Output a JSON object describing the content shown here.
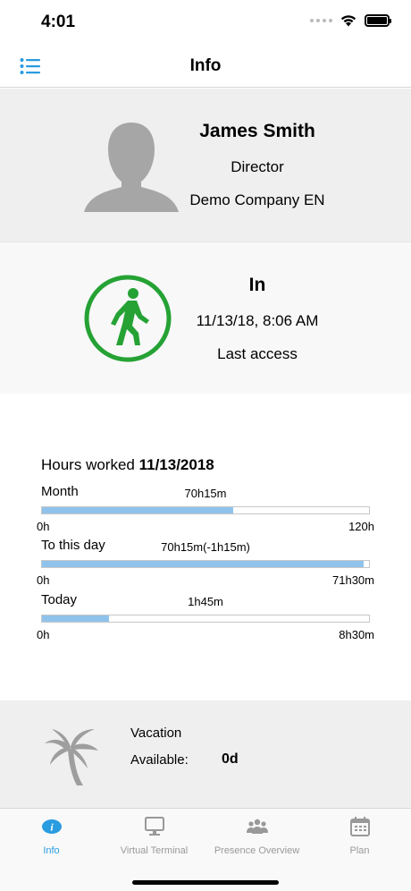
{
  "status_bar": {
    "time": "4:01"
  },
  "nav": {
    "title": "Info"
  },
  "profile": {
    "name": "James Smith",
    "role": "Director",
    "company": "Demo Company EN"
  },
  "presence": {
    "state": "In",
    "timestamp": "11/13/18, 8:06 AM",
    "label": "Last access",
    "color": "#26a235"
  },
  "hours": {
    "title_prefix": "Hours worked",
    "date": "11/13/2018",
    "rows": [
      {
        "label": "Month",
        "value": "70h15m",
        "min": "0h",
        "max": "120h",
        "fraction": 0.585
      },
      {
        "label": "To this day",
        "value": "70h15m(-1h15m)",
        "min": "0h",
        "max": "71h30m",
        "fraction": 0.983
      },
      {
        "label": "Today",
        "value": "1h45m",
        "min": "0h",
        "max": "8h30m",
        "fraction": 0.206
      }
    ]
  },
  "vacation": {
    "title": "Vacation",
    "available_label": "Available:",
    "available_value": "0d"
  },
  "tabs": [
    {
      "label": "Info",
      "icon": "info-icon",
      "active": true
    },
    {
      "label": "Virtual Terminal",
      "icon": "monitor-icon",
      "active": false
    },
    {
      "label": "Presence Overview",
      "icon": "people-icon",
      "active": false
    },
    {
      "label": "Plan",
      "icon": "calendar-icon",
      "active": false
    }
  ],
  "colors": {
    "accent": "#2a9ce0",
    "progress": "#8fc3ec",
    "presence_in": "#26a235"
  }
}
